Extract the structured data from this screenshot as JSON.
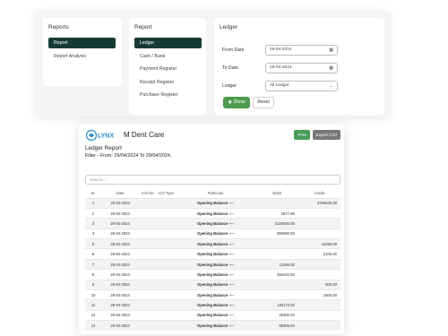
{
  "reports_card": {
    "title": "Reports",
    "items": [
      {
        "label": "Report"
      },
      {
        "label": "Report Analysis"
      }
    ]
  },
  "report_card": {
    "title": "Report",
    "items": [
      {
        "label": "Ledger"
      },
      {
        "label": "Cash / Bank"
      },
      {
        "label": "Payment Register"
      },
      {
        "label": "Receipt Register"
      },
      {
        "label": "Purchase Register"
      }
    ]
  },
  "ledger_card": {
    "title": "Ledger",
    "from_label": "From Date",
    "from_value": "29-04-2024",
    "to_label": "To Date",
    "to_value": "29-04-2024",
    "ledger_label": "Ledger",
    "ledger_value": "All Ledger",
    "show_label": "Show",
    "reset_label": "Reset"
  },
  "report": {
    "logo_text": "LYNX",
    "clinic_name": "M Dent Care",
    "print_label": "Print",
    "export_label": "Export CSV",
    "title": "Ledger Report",
    "filter_text": "Filter - From: 29/04/2024 To 29/04/2024,",
    "search_placeholder": "Search...",
    "columns": [
      "Sr.",
      "Date",
      "Vch No.",
      "Vch Type",
      "Particular",
      "Debit",
      "Credit"
    ],
    "rows": [
      {
        "sr": "1",
        "date": "29-04-2024",
        "particular": "Opening Balance ----",
        "debit": "",
        "credit": "3766545.00"
      },
      {
        "sr": "2",
        "date": "29-04-2024",
        "particular": "Opening Balance ----",
        "debit": "2877.96",
        "credit": ""
      },
      {
        "sr": "3",
        "date": "29-04-2024",
        "particular": "Opening Balance ----",
        "debit": "3100500.00",
        "credit": ""
      },
      {
        "sr": "4",
        "date": "29-04-2024",
        "particular": "Opening Balance ----",
        "debit": "550000.00",
        "credit": ""
      },
      {
        "sr": "5",
        "date": "29-04-2024",
        "particular": "Opening Balance ----",
        "debit": "",
        "credit": "11456.00"
      },
      {
        "sr": "6",
        "date": "29-04-2024",
        "particular": "Opening Balance ----",
        "debit": "",
        "credit": "2105.00"
      },
      {
        "sr": "7",
        "date": "29-04-2024",
        "particular": "Opening Balance ----",
        "debit": "11455.00",
        "credit": ""
      },
      {
        "sr": "8",
        "date": "29-04-2024",
        "particular": "Opening Balance ----",
        "debit": "356432.00",
        "credit": ""
      },
      {
        "sr": "9",
        "date": "29-04-2024",
        "particular": "Opening Balance ----",
        "debit": "",
        "credit": "500.00"
      },
      {
        "sr": "10",
        "date": "29-04-2024",
        "particular": "Opening Balance ----",
        "debit": "",
        "credit": "1600.00"
      },
      {
        "sr": "11",
        "date": "29-04-2024",
        "particular": "Opening Balance ----",
        "debit": "146170.00",
        "credit": ""
      },
      {
        "sr": "12",
        "date": "29-04-2024",
        "particular": "Opening Balance ----",
        "debit": "49300.00",
        "credit": ""
      },
      {
        "sr": "13",
        "date": "29-04-2024",
        "particular": "Opening Balance ----",
        "debit": "95305.00",
        "credit": ""
      }
    ]
  },
  "icons": {
    "calendar": "calendar-icon",
    "chevron": "chevron-down-icon",
    "show": "eye-icon"
  },
  "colors": {
    "active_nav": "#173b33",
    "show_button": "#4c9a4c",
    "print_button": "#4a9a58",
    "export_button": "#777777"
  }
}
